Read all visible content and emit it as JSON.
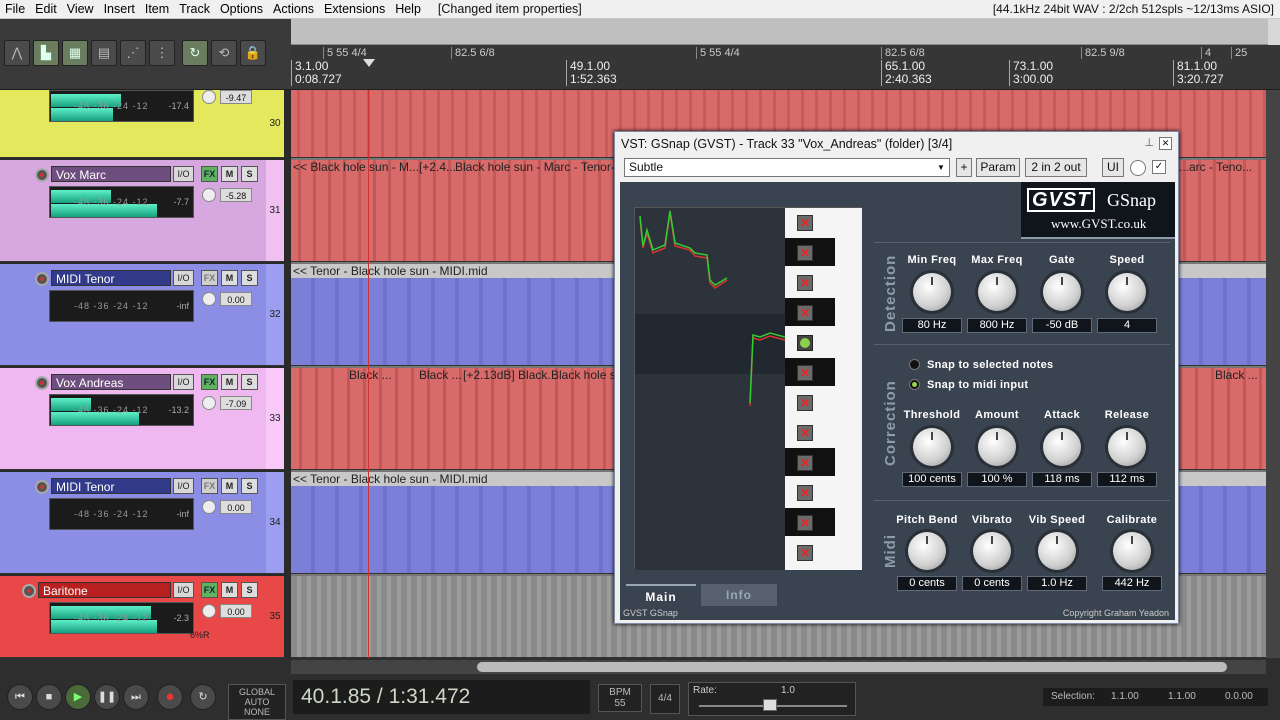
{
  "menubar": {
    "items": [
      "File",
      "Edit",
      "View",
      "Insert",
      "Item",
      "Track",
      "Options",
      "Actions",
      "Extensions",
      "Help"
    ],
    "status": "[Changed item properties]",
    "audio_info": "[44.1kHz 24bit WAV : 2/2ch 512spls ~12/13ms ASIO]"
  },
  "ruler": {
    "markers": [
      "5 55 4/4",
      "82.5 6/8",
      "5 55 4/4",
      "82.5 6/8",
      "82.5 9/8",
      "4",
      "25"
    ],
    "times": [
      {
        "bar": "3.1.00",
        "time": "0:08.727"
      },
      {
        "bar": "49.1.00",
        "time": "1:52.363"
      },
      {
        "bar": "65.1.00",
        "time": "2:40.363"
      },
      {
        "bar": "73.1.00",
        "time": "3:00.00"
      },
      {
        "bar": "81.1.00",
        "time": "3:20.727"
      }
    ]
  },
  "tracks": [
    {
      "name": "",
      "num": "30",
      "vol": "-9.47",
      "peak": "-17.4",
      "io": "I/O",
      "fx": "FX",
      "m": "M",
      "s": "S"
    },
    {
      "name": "Vox  Marc",
      "num": "31",
      "vol": "-5.28",
      "peak": "-7.7",
      "io": "I/O",
      "fx": "FX",
      "m": "M",
      "s": "S"
    },
    {
      "name": "MIDI  Tenor",
      "num": "32",
      "vol": "0.00",
      "peak": "-inf",
      "io": "I/O",
      "fx": "FX",
      "m": "M",
      "s": "S"
    },
    {
      "name": "Vox  Andreas",
      "num": "33",
      "vol": "-7.09",
      "peak": "-13.2",
      "io": "I/O",
      "fx": "FX",
      "m": "M",
      "s": "S"
    },
    {
      "name": "MIDI  Tenor",
      "num": "34",
      "vol": "0.00",
      "peak": "-inf",
      "io": "I/O",
      "fx": "FX",
      "m": "M",
      "s": "S"
    },
    {
      "name": "Baritone",
      "num": "35",
      "vol": "0.00",
      "peak": "-2.3",
      "io": "I/O",
      "fx": "FX",
      "m": "M",
      "s": "S",
      "pan": "6%R"
    }
  ],
  "meter_scale": "-48  -36  -24  -12",
  "clips": {
    "lane31": [
      "<< Black hole sun - M...",
      "[+2.4...",
      "Black hole sun - Marc - Tenor-glue",
      "...arc - Teno..."
    ],
    "lane32": "<< Tenor - Black hole sun - MIDI.mid",
    "lane33": [
      "Black ...",
      "Black ...",
      "[+2.13dB] Black...",
      "Black hole su",
      "Black ..."
    ],
    "lane34": "<< Tenor - Black hole sun - MIDI.mid"
  },
  "gsnap": {
    "title": "VST: GSnap (GVST) - Track 33 \"Vox_Andreas\" (folder) [3/4]",
    "preset": "Subtle",
    "plus_label": "+",
    "param_label": "Param",
    "io_label": "2 in 2 out",
    "ui_label": "UI",
    "logo_gvst": "GVST",
    "logo_name": "GSnap",
    "logo_url": "www.GVST.co.uk",
    "sections": {
      "detection": "Detection",
      "correction": "Correction",
      "midi": "Midi"
    },
    "detection": [
      {
        "label": "Min Freq",
        "value": "80 Hz"
      },
      {
        "label": "Max Freq",
        "value": "800 Hz"
      },
      {
        "label": "Gate",
        "value": "-50 dB"
      },
      {
        "label": "Speed",
        "value": "4"
      }
    ],
    "snap_options": [
      "Snap to selected notes",
      "Snap to midi input"
    ],
    "correction": [
      {
        "label": "Threshold",
        "value": "100 cents"
      },
      {
        "label": "Amount",
        "value": "100 %"
      },
      {
        "label": "Attack",
        "value": "118 ms"
      },
      {
        "label": "Release",
        "value": "112 ms"
      }
    ],
    "midi": [
      {
        "label": "Pitch Bend",
        "value": "0 cents"
      },
      {
        "label": "Vibrato",
        "value": "0 cents"
      },
      {
        "label": "Vib Speed",
        "value": "1.0 Hz"
      },
      {
        "label": "Calibrate",
        "value": "442 Hz"
      }
    ],
    "tabs": [
      "Main",
      "Info"
    ],
    "footer_left": "GVST GSnap",
    "footer_right": "Copyright Graham Yeadon"
  },
  "transport": {
    "time": "40.1.85 / 1:31.472",
    "global_auto": "GLOBAL AUTO",
    "auto_mode": "NONE",
    "bpm_label": "BPM",
    "bpm": "55",
    "timesig": "4/4",
    "rate_label": "Rate:",
    "rate": "1.0",
    "selection_label": "Selection:",
    "sel_start": "1.1.00",
    "sel_end": "1.1.00",
    "sel_len": "0.0.00"
  },
  "colors": {
    "audio_clip": "#d86a6a",
    "midi_lane": "#7b7fd8",
    "track30": "#e3e85c",
    "track31": "#d7a8e0",
    "track32": "#8c8ee6",
    "track33": "#f0b8f0",
    "track34": "#8c8ee6",
    "track35": "#e84848",
    "plugin_bg": "#3a4350"
  }
}
